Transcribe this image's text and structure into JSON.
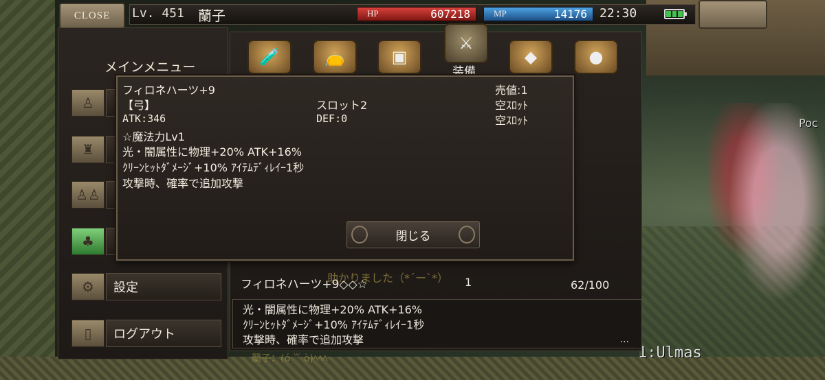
{
  "status": {
    "close_label": "CLOSE",
    "level": "Lv. 451",
    "player_name": "蘭子",
    "hp_label": "HP",
    "hp_value": "607218",
    "mp_label": "MP",
    "mp_value": "14176",
    "clock": "22:30"
  },
  "main_menu": {
    "title": "メインメニュー",
    "items": [
      {
        "label": "",
        "icon": "person-icon"
      },
      {
        "label": "",
        "icon": "bag-icon"
      },
      {
        "label": "",
        "icon": "group-icon"
      },
      {
        "label": "",
        "icon": "island-icon"
      },
      {
        "label": "設定",
        "icon": "settings-icon"
      },
      {
        "label": "ログアウト",
        "icon": "door-icon"
      }
    ]
  },
  "inventory": {
    "active_tab_label": "装備",
    "tabs": [
      "potion-icon",
      "pouch-icon",
      "chest-icon",
      "sword-icon",
      "crystal-icon",
      "orb-icon"
    ],
    "row": {
      "name": "フィロネハーツ+9◇◇☆",
      "count": "1",
      "capacity": "62/100"
    },
    "description": [
      "光・闇属性に物理+20% ATK+16%",
      "ｸﾘｰﾝﾋｯﾄﾀﾞﾒｰｼﾞ+10% ｱｲﾃﾑﾃﾞｨﾚｲｰ1秒",
      "攻撃時、確率で追加攻撃"
    ],
    "more": "..."
  },
  "item_detail": {
    "name": "フィロネハーツ+9",
    "type": "【弓】",
    "atk": "ATK:346",
    "slot": "スロット2",
    "def": "DEF:0",
    "sell": "売値:1",
    "slot1": "空ｽﾛｯﾄ",
    "slot2": "空ｽﾛｯﾄ",
    "enchant": "☆魔法力Lv1",
    "effects": [
      "光・闇属性に物理+20% ATK+16%",
      "ｸﾘｰﾝﾋｯﾄﾀﾞﾒｰｼﾞ+10% ｱｲﾃﾑﾃﾞｨﾚｲｰ1秒",
      "攻撃時、確率で追加攻撃"
    ],
    "close_button": "閉じる"
  },
  "scene": {
    "chat_faint": "助かりました（*´ー`*）",
    "chat_bottom": "蘭子：(ó ꒳ ò)ﾍﾍﾍ",
    "player_tag": "1:Ulmas",
    "npc_name": "Poc"
  },
  "colors": {
    "hp": "#d9413b",
    "mp": "#4da3e3",
    "panel": "#2b2521",
    "battery": "#43c24f"
  }
}
